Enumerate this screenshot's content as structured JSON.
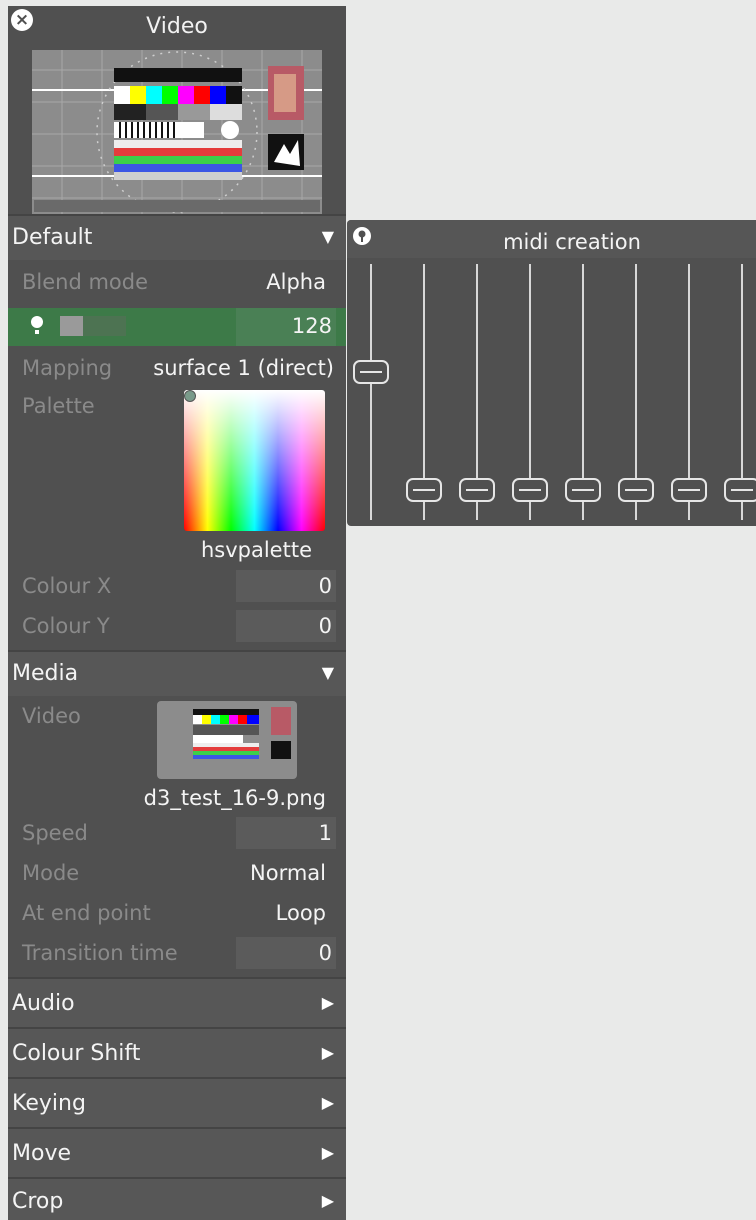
{
  "video_panel": {
    "title": "Video",
    "sections": {
      "default": {
        "label": "Default",
        "blend_mode": {
          "label": "Blend mode",
          "value": "Alpha"
        },
        "opacity": {
          "value": "128",
          "fill_fraction": 0.5
        },
        "mapping": {
          "label": "Mapping",
          "value": "surface 1 (direct)"
        },
        "palette": {
          "label": "Palette",
          "value": "hsvpalette"
        },
        "colour_x": {
          "label": "Colour X",
          "value": "0"
        },
        "colour_y": {
          "label": "Colour Y",
          "value": "0"
        }
      },
      "media": {
        "label": "Media",
        "video": {
          "label": "Video",
          "file": "d3_test_16-9.png"
        },
        "speed": {
          "label": "Speed",
          "value": "1"
        },
        "mode": {
          "label": "Mode",
          "value": "Normal"
        },
        "at_end_point": {
          "label": "At end point",
          "value": "Loop"
        },
        "transition_time": {
          "label": "Transition time",
          "value": "0"
        }
      },
      "collapsed": [
        {
          "label": "Audio"
        },
        {
          "label": "Colour Shift"
        },
        {
          "label": "Keying"
        },
        {
          "label": "Move"
        },
        {
          "label": "Crop"
        }
      ]
    }
  },
  "midi_panel": {
    "title": "midi creation",
    "faders": [
      0.55,
      0.0,
      0.0,
      0.0,
      0.0,
      0.0,
      0.0,
      0.0
    ]
  },
  "colors": {
    "panel_bg": "#505050",
    "highlight_green": "#3d7a48",
    "page_bg": "#e9eae9"
  }
}
